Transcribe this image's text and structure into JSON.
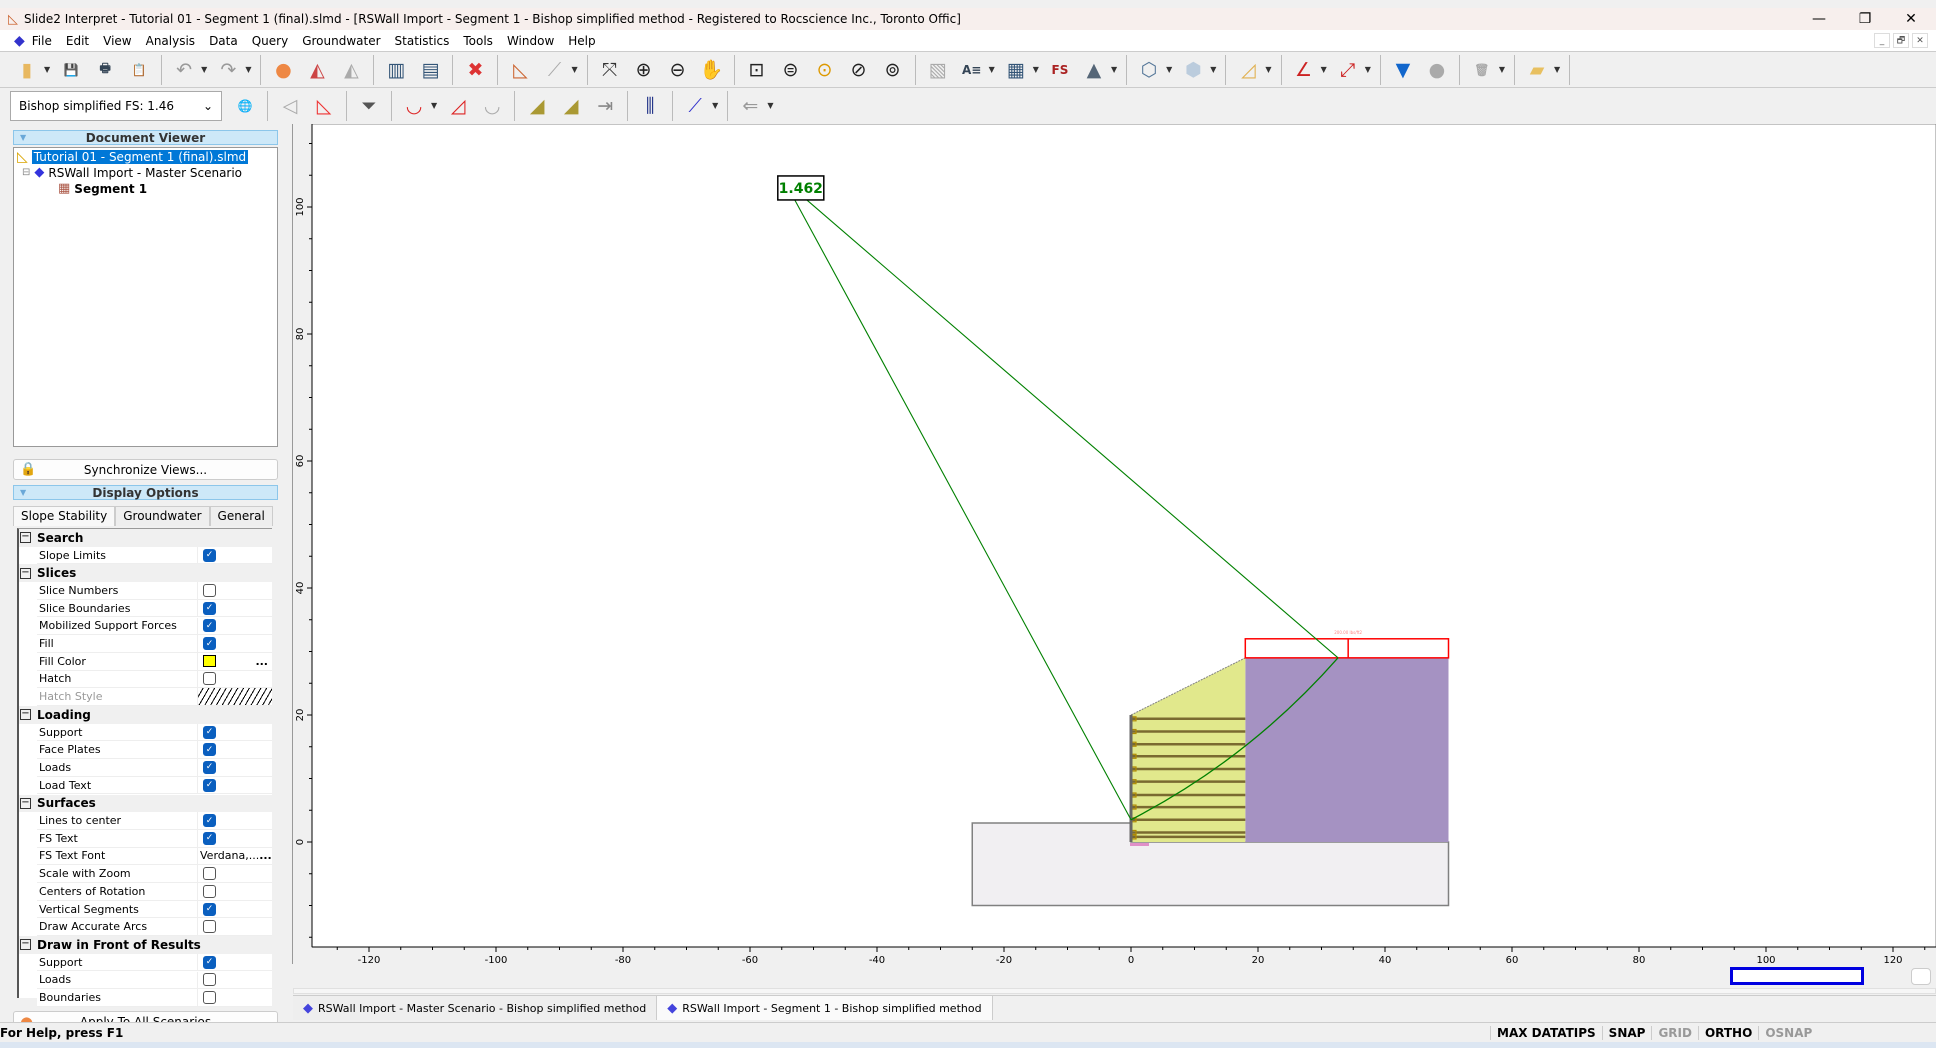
{
  "window": {
    "title": "Slide2 Interpret - Tutorial 01 - Segment 1 (final).slmd - [RSWall Import - Segment 1 - Bishop simplified method - Registered to Rocscience Inc., Toronto Offic]",
    "minimize": "—",
    "restore": "❐",
    "close": "✕"
  },
  "menu": [
    "File",
    "Edit",
    "View",
    "Analysis",
    "Data",
    "Query",
    "Groundwater",
    "Statistics",
    "Tools",
    "Window",
    "Help"
  ],
  "mdi_controls": [
    "_",
    "🗗",
    "✕"
  ],
  "toolbar1": [
    {
      "name": "open-icon",
      "g": "▮",
      "c": "#e8b860",
      "dd": true
    },
    {
      "name": "save-icon",
      "g": "💾",
      "c": "#335"
    },
    {
      "name": "print-icon",
      "g": "🖶",
      "c": "#345"
    },
    {
      "name": "print-preview-icon",
      "g": "📋",
      "c": "#384"
    },
    {
      "sep": true
    },
    {
      "name": "undo-icon",
      "g": "↶",
      "c": "#999",
      "dd": true
    },
    {
      "name": "redo-icon",
      "g": "↷",
      "c": "#999",
      "dd": true
    },
    {
      "sep": true
    },
    {
      "name": "color-wheel-icon",
      "g": "●",
      "c": "#e84"
    },
    {
      "name": "contour-legend-icon",
      "g": "◭",
      "c": "#c44"
    },
    {
      "name": "contour-gray-icon",
      "g": "◭",
      "c": "#aaa"
    },
    {
      "sep": true
    },
    {
      "name": "tile-vertical-icon",
      "g": "▥",
      "c": "#357"
    },
    {
      "name": "tile-horizontal-icon",
      "g": "▤",
      "c": "#357"
    },
    {
      "sep": true
    },
    {
      "name": "close-view-icon",
      "g": "✖",
      "c": "#d33"
    },
    {
      "sep": true
    },
    {
      "name": "slope-icon",
      "g": "◺",
      "c": "#c63"
    },
    {
      "name": "graph-icon",
      "g": "⟋",
      "c": "#aaa",
      "dd": true
    },
    {
      "sep": true
    },
    {
      "name": "zoom-all-icon",
      "g": "⤧",
      "c": "#333"
    },
    {
      "name": "zoom-in-icon",
      "g": "⊕",
      "c": "#222"
    },
    {
      "name": "zoom-out-icon",
      "g": "⊖",
      "c": "#222"
    },
    {
      "name": "pan-icon",
      "g": "✋",
      "c": "#c93"
    },
    {
      "sep": true
    },
    {
      "name": "zoom-window-icon",
      "g": "⊡",
      "c": "#222"
    },
    {
      "name": "zoom-extents-icon",
      "g": "⊜",
      "c": "#222"
    },
    {
      "name": "zoom-previous-icon",
      "g": "⊙",
      "c": "#d90"
    },
    {
      "name": "zoom-bookmark-icon",
      "g": "⊘",
      "c": "#222"
    },
    {
      "name": "zoom-lock-icon",
      "g": "⊚",
      "c": "#222"
    },
    {
      "sep": true
    },
    {
      "name": "datatips-icon",
      "g": "▧",
      "c": "#aaa"
    },
    {
      "name": "text-box-icon",
      "g": "A≡",
      "c": "#345",
      "dd": true
    },
    {
      "name": "table-icon",
      "g": "▦",
      "c": "#357",
      "dd": true
    },
    {
      "name": "fs-label-icon",
      "g": "FS",
      "c": "#a22"
    },
    {
      "name": "image-icon",
      "g": "▲",
      "c": "#567",
      "dd": true
    },
    {
      "sep": true
    },
    {
      "name": "polyline-icon",
      "g": "⬡",
      "c": "#579",
      "dd": true
    },
    {
      "name": "polygon-icon",
      "g": "⬢",
      "c": "#bcd",
      "dd": true
    },
    {
      "sep": true
    },
    {
      "name": "ruler-triangle-icon",
      "g": "◿",
      "c": "#e0b050",
      "dd": true
    },
    {
      "sep": true
    },
    {
      "name": "angle-icon",
      "g": "∠",
      "c": "#c22",
      "dd": true
    },
    {
      "name": "dimension-icon",
      "g": "⤢",
      "c": "#c22",
      "dd": true
    },
    {
      "sep": true
    },
    {
      "name": "water-table-icon",
      "g": "▼",
      "c": "#16c"
    },
    {
      "name": "sphere-icon",
      "g": "●",
      "c": "#aaa"
    },
    {
      "sep": true
    },
    {
      "name": "delete-icon",
      "g": "🗑",
      "c": "#aaa",
      "dd": true
    },
    {
      "sep": true
    },
    {
      "name": "layers-icon",
      "g": "▰",
      "c": "#e8c060",
      "dd": true
    },
    {
      "sep": true
    }
  ],
  "fs_select": {
    "value": "Bishop simplified FS:  1.46",
    "arrow": "⌄"
  },
  "toolbar2": [
    {
      "name": "globe-icon",
      "g": "🌐",
      "c": "#268"
    },
    {
      "sep": true
    },
    {
      "name": "slip-surface-gray-icon",
      "g": "◁",
      "c": "#aaa"
    },
    {
      "name": "all-surfaces-icon",
      "g": "◺",
      "c": "#e33"
    },
    {
      "sep": true
    },
    {
      "name": "filter-surfaces-icon",
      "g": "⏷",
      "c": "#555"
    },
    {
      "sep": true
    },
    {
      "name": "add-surface-icon",
      "g": "◡",
      "c": "#d22",
      "dd": true
    },
    {
      "name": "surface-region-icon",
      "g": "◿",
      "c": "#d22"
    },
    {
      "name": "delete-surface-icon",
      "g": "◡",
      "c": "#aaa"
    },
    {
      "sep": true
    },
    {
      "name": "slices-icon",
      "g": "◢",
      "c": "#a93"
    },
    {
      "name": "slices-2-icon",
      "g": "◢",
      "c": "#a93"
    },
    {
      "name": "forces-icon",
      "g": "⇥",
      "c": "#888"
    },
    {
      "sep": true
    },
    {
      "name": "histogram-icon",
      "g": "⫼",
      "c": "#238"
    },
    {
      "sep": true
    },
    {
      "name": "query-line-icon",
      "g": "⟋",
      "c": "#33c",
      "dd": true
    },
    {
      "sep": true
    },
    {
      "name": "flow-icon",
      "g": "⇐",
      "c": "#999",
      "dd": true
    }
  ],
  "document_viewer": {
    "title": "Document Viewer",
    "collapse": "▼",
    "tree": [
      {
        "label": "Tutorial 01 - Segment 1 (final).slmd",
        "icon": "slmd-file-icon",
        "selected": true
      },
      {
        "label": "RSWall Import - Master Scenario",
        "icon": "master-scenario-icon",
        "expander": "⊟"
      },
      {
        "label": "Segment 1",
        "icon": "computed-segment-icon",
        "bold": true
      }
    ]
  },
  "sync_button": "Synchronize Views...",
  "display_options": {
    "title": "Display Options",
    "tabs": [
      "Slope Stability",
      "Groundwater",
      "General"
    ],
    "active_tab": 0,
    "rows": [
      {
        "group": "Search"
      },
      {
        "label": "Slope Limits",
        "type": "check",
        "checked": true
      },
      {
        "group": "Slices"
      },
      {
        "label": "Slice Numbers",
        "type": "check",
        "checked": false
      },
      {
        "label": "Slice Boundaries",
        "type": "check",
        "checked": true
      },
      {
        "label": "Mobilized Support Forces",
        "type": "check",
        "checked": true
      },
      {
        "label": "Fill",
        "type": "check",
        "checked": true
      },
      {
        "label": "Fill Color",
        "type": "color",
        "color": "#ffff00",
        "more": "..."
      },
      {
        "label": "Hatch",
        "type": "check",
        "checked": false
      },
      {
        "label": "Hatch Style",
        "type": "hatch",
        "disabled": true
      },
      {
        "group": "Loading"
      },
      {
        "label": "Support",
        "type": "check",
        "checked": true
      },
      {
        "label": "Face Plates",
        "type": "check",
        "checked": true
      },
      {
        "label": "Loads",
        "type": "check",
        "checked": true
      },
      {
        "label": "Load Text",
        "type": "check",
        "checked": true
      },
      {
        "group": "Surfaces"
      },
      {
        "label": "Lines to center",
        "type": "check",
        "checked": true
      },
      {
        "label": "FS Text",
        "type": "check",
        "checked": true
      },
      {
        "label": "FS Text Font",
        "type": "text",
        "value": "Verdana,...",
        "more": "..."
      },
      {
        "label": "Scale with Zoom",
        "type": "check",
        "checked": false
      },
      {
        "label": "Centers of Rotation",
        "type": "check",
        "checked": false
      },
      {
        "label": "Vertical Segments",
        "type": "check",
        "checked": true
      },
      {
        "label": "Draw Accurate Arcs",
        "type": "check",
        "checked": false
      },
      {
        "group": "Draw in Front of Results"
      },
      {
        "label": "Support",
        "type": "check",
        "checked": true
      },
      {
        "label": "Loads",
        "type": "check",
        "checked": false
      },
      {
        "label": "Boundaries",
        "type": "check",
        "checked": false
      }
    ]
  },
  "apply_button": "Apply To All Scenarios",
  "model": {
    "fs_label": "1.462",
    "slip_center": [
      -52,
      103
    ],
    "slip_entry": [
      0,
      3.5
    ],
    "slip_exit": [
      32.6,
      29
    ],
    "x_ticks": [
      -120,
      -100,
      -80,
      -60,
      -40,
      -20,
      0,
      20,
      40,
      60,
      80,
      100,
      120
    ],
    "y_ticks": [
      0,
      20,
      40,
      60,
      80,
      100
    ],
    "x_range": [
      -129,
      125
    ],
    "y_range": [
      -16.5,
      113
    ],
    "foundation": [
      [
        -25,
        3
      ],
      [
        0,
        3
      ],
      [
        0,
        0
      ],
      [
        50,
        0
      ],
      [
        50,
        -10
      ],
      [
        -25,
        -10
      ]
    ],
    "reinforced_zone": [
      [
        0,
        0
      ],
      [
        0,
        20
      ],
      [
        18,
        29
      ],
      [
        18,
        0
      ]
    ],
    "retained_soil": [
      [
        18,
        0
      ],
      [
        18,
        29
      ],
      [
        50,
        29
      ],
      [
        50,
        0
      ]
    ],
    "reinforcement_levels": [
      19.4,
      17.4,
      15.4,
      13.5,
      11.5,
      9.5,
      7.4,
      5.5,
      3.5,
      1.5,
      0.8
    ],
    "surcharge": {
      "x": [
        18,
        50
      ],
      "y": [
        29,
        32
      ],
      "divider": 34.2,
      "label": "200.00 lbs/ft2"
    },
    "colors": {
      "reinforced": "#e1e88c",
      "retained": "#a592c2",
      "foundation": "#f1eff2",
      "slip": "#008000",
      "load": "#ff0000",
      "reinforcement": "#7a6a30",
      "footing": "#e090c8"
    }
  },
  "doc_tabs": [
    {
      "label": "RSWall Import - Master Scenario - Bishop simplified method",
      "active": false
    },
    {
      "label": "RSWall Import - Segment 1 - Bishop simplified method",
      "active": true
    }
  ],
  "status": {
    "help": "For Help, press F1",
    "items": [
      {
        "label": "MAX DATATIPS",
        "on": true
      },
      {
        "label": "SNAP",
        "on": true
      },
      {
        "label": "GRID",
        "on": false
      },
      {
        "label": "ORTHO",
        "on": true
      },
      {
        "label": "OSNAP",
        "on": false
      }
    ]
  }
}
